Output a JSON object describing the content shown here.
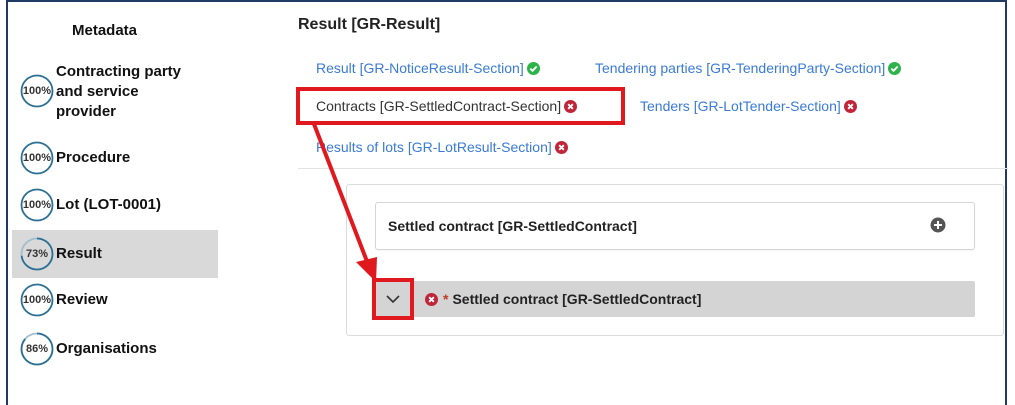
{
  "sidebar": {
    "metadata_label": "Metadata",
    "items": [
      {
        "pct": "100%",
        "label_lines": [
          "Contracting party",
          "and service",
          "provider"
        ],
        "fraction": 1.0
      },
      {
        "pct": "100%",
        "label_lines": [
          "Procedure"
        ],
        "fraction": 1.0
      },
      {
        "pct": "100%",
        "label_lines": [
          "Lot (LOT-0001)"
        ],
        "fraction": 1.0
      },
      {
        "pct": "73%",
        "label_lines": [
          "Result"
        ],
        "fraction": 0.73,
        "active": true
      },
      {
        "pct": "100%",
        "label_lines": [
          "Review"
        ],
        "fraction": 1.0
      },
      {
        "pct": "86%",
        "label_lines": [
          "Organisations"
        ],
        "fraction": 0.86
      }
    ]
  },
  "main": {
    "title": "Result [GR-Result]",
    "tabs": [
      {
        "label": "Result  [GR-NoticeResult-Section]",
        "status": "ok"
      },
      {
        "label": "Tendering parties  [GR-TenderingParty-Section]",
        "status": "ok"
      },
      {
        "label": "Contracts  [GR-SettledContract-Section]",
        "status": "error",
        "current": true
      },
      {
        "label": "Tenders  [GR-LotTender-Section]",
        "status": "error"
      },
      {
        "label": "Results of lots  [GR-LotResult-Section]",
        "status": "error"
      }
    ],
    "settled_group_title": "Settled contract  [GR-SettledContract]",
    "settled_item_required_mark": "*",
    "settled_item_title": "Settled contract  [GR-SettledContract]"
  },
  "colors": {
    "link": "#3a7bd5",
    "ok": "#2db34a",
    "error": "#c0253a",
    "ring": "#2b6f93",
    "annotation": "#e0191f"
  }
}
